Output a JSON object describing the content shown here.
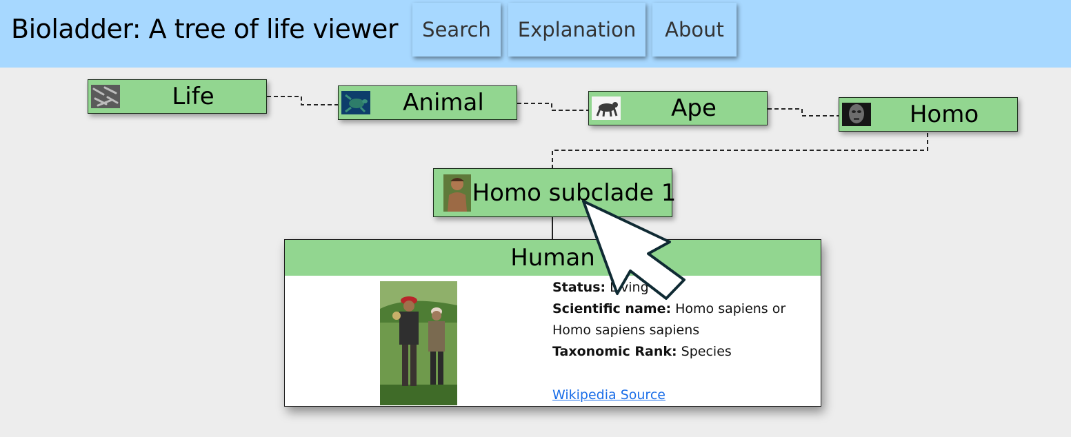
{
  "header": {
    "title": "Bioladder: A tree of life viewer",
    "nav": [
      {
        "label": "Search"
      },
      {
        "label": "Explanation"
      },
      {
        "label": "About"
      }
    ]
  },
  "tree": {
    "ancestors": [
      {
        "label": "Life",
        "thumb_icon": "bacteria-thumbnail"
      },
      {
        "label": "Animal",
        "thumb_icon": "sea-turtle-thumbnail"
      },
      {
        "label": "Ape",
        "thumb_icon": "ape-thumbnail"
      },
      {
        "label": "Homo",
        "thumb_icon": "homo-skull-thumbnail"
      }
    ],
    "current": {
      "label": "Homo subclade 1",
      "thumb_icon": "early-human-thumbnail"
    }
  },
  "detail": {
    "title": "Human",
    "status_label": "Status:",
    "status_value": "Living",
    "sci_label": "Scientific name:",
    "sci_value": "Homo sapiens or Homo sapiens sapiens",
    "rank_label": "Taxonomic Rank:",
    "rank_value": "Species",
    "link_text": "Wikipedia Source",
    "photo_icon": "two-people-photo"
  },
  "colors": {
    "header_bg": "#a7d8ff",
    "node_green": "#92d690",
    "link_blue": "#1a6ee8",
    "page_bg": "#ededed"
  }
}
